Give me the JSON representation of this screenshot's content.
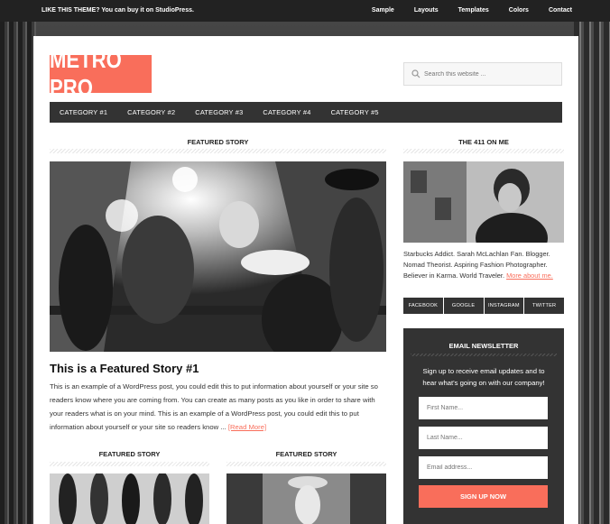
{
  "topbar": {
    "promo": "LIKE THIS THEME? You can buy it on StudioPress.",
    "nav": [
      "Sample",
      "Layouts",
      "Templates",
      "Colors",
      "Contact"
    ]
  },
  "header": {
    "logo": "METRO PRO",
    "search_placeholder": "Search this website ..."
  },
  "categories": [
    "CATEGORY #1",
    "CATEGORY #2",
    "CATEGORY #3",
    "CATEGORY #4",
    "CATEGORY #5"
  ],
  "main": {
    "section_title": "FEATURED STORY",
    "story_title": "This is a Featured Story #1",
    "story_body": "This is an example of a WordPress post, you could edit this to put information about yourself or your site so readers know where you are coming from. You can create as many posts as you like in order to share with your readers what is on your mind. This is an example of a WordPress post, you could edit this to put information about yourself or your site so readers know ...",
    "read_more": "[Read More]",
    "featured_left_title": "FEATURED STORY",
    "featured_right_title": "FEATURED STORY"
  },
  "sidebar": {
    "about_title": "THE 411 ON ME",
    "about_text": "Starbucks Addict. Sarah McLachlan Fan. Blogger. Nomad Theorist. Aspiring Fashion Photographer. Believer in Karma. World Traveler.",
    "about_link": "More about me.",
    "social": [
      "FACEBOOK",
      "GOOGLE",
      "INSTAGRAM",
      "TWITTER"
    ],
    "newsletter": {
      "title": "EMAIL NEWSLETTER",
      "text": "Sign up to receive email updates and to hear what's going on with our company!",
      "first_name_placeholder": "First Name...",
      "last_name_placeholder": "Last Name...",
      "email_placeholder": "Email address...",
      "button": "SIGN UP NOW"
    }
  },
  "colors": {
    "accent": "#f96e5b",
    "dark": "#333333",
    "topbar": "#222222"
  }
}
